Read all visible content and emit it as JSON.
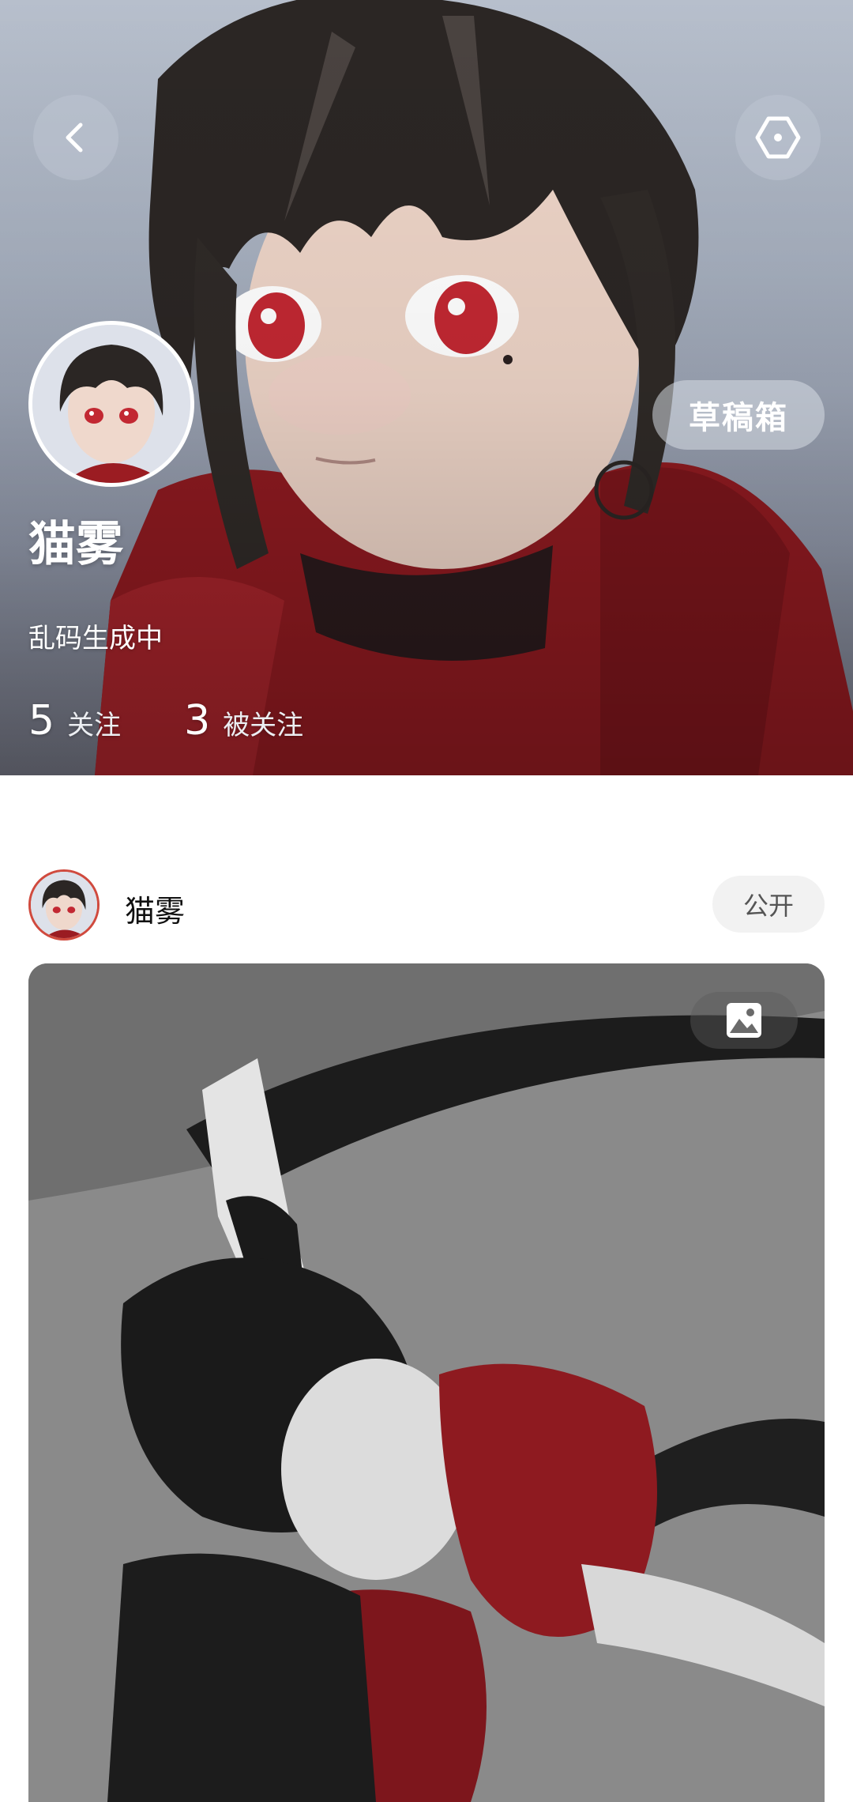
{
  "profile": {
    "username": "猫雾",
    "bio": "乱码生成中",
    "following_count": "5",
    "following_label": "关注",
    "followers_count": "3",
    "followers_label": "被关注",
    "drafts_label": "草稿箱"
  },
  "icons": {
    "back": "chevron-left-icon",
    "settings": "hexagon-settings-icon",
    "image_type": "image-icon"
  },
  "post": {
    "author": "猫雾",
    "visibility": "公开"
  },
  "colors": {
    "avatar_ring": "#d04a3e",
    "scarf_red": "#9b1c22",
    "eye_red": "#d8303a"
  }
}
